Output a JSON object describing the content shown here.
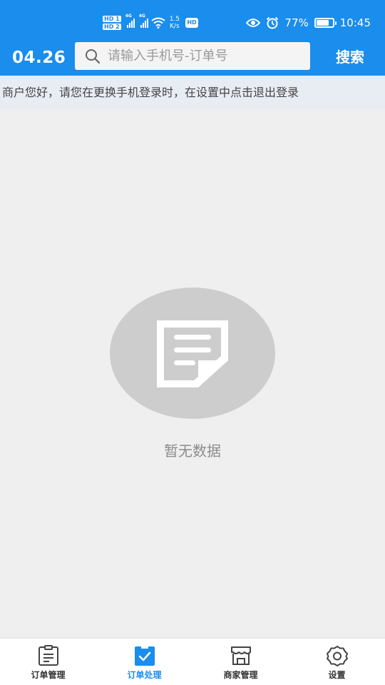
{
  "status_bar": {
    "hd1": "HD 1",
    "hd2": "HD 2",
    "net1": "4G",
    "net2": "4G",
    "speed_value": "1.5",
    "speed_unit": "K/s",
    "app_badge": "HD",
    "battery": "77%",
    "battery_level": 0.77,
    "time": "10:45"
  },
  "header": {
    "date": "04.26",
    "search_placeholder": "请输入手机号-订单号",
    "search_button": "搜索"
  },
  "notice": {
    "text": "商户您好，请您在更换手机登录时，在设置中点击退出登录"
  },
  "empty_state": {
    "text": "暂无数据"
  },
  "tabs": [
    {
      "label": "订单管理",
      "icon": "clipboard-icon",
      "active": false
    },
    {
      "label": "订单处理",
      "icon": "check-clipboard-icon",
      "active": true
    },
    {
      "label": "商家管理",
      "icon": "store-icon",
      "active": false
    },
    {
      "label": "设置",
      "icon": "gear-icon",
      "active": false
    }
  ],
  "colors": {
    "primary": "#1a8ded",
    "background": "#efefef",
    "notice_bg": "#e8ecf3",
    "empty_circle": "#cdcdcd"
  }
}
